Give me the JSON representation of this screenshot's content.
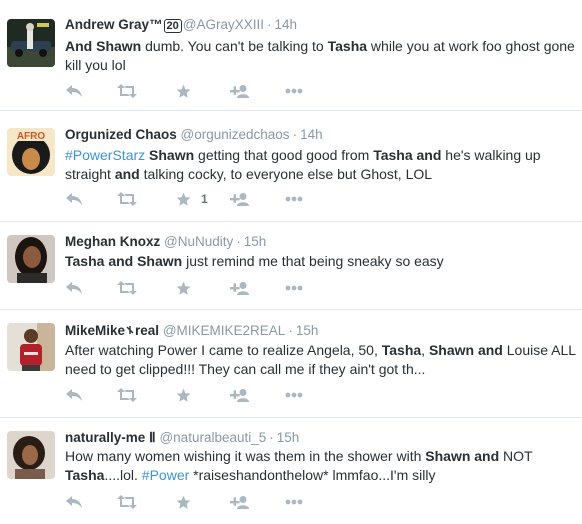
{
  "tweets": [
    {
      "name": "Andrew Gray™",
      "name_extra": "",
      "name_badge": "20",
      "handle": "@AGrayXXIII",
      "sep": "·",
      "time": "14h",
      "avatar_icon": "avatar-night-car-photo",
      "text": [
        {
          "t": "And Shawn",
          "b": true
        },
        {
          "t": " dumb. You can't be talking to "
        },
        {
          "t": "Tasha",
          "b": true
        },
        {
          "t": " while you at work foo ghost gone kill you lol"
        }
      ],
      "favorite_count": ""
    },
    {
      "name": "Orgunized Chaos",
      "name_extra": "",
      "name_badge": "",
      "handle": "@orgunizedchaos",
      "sep": "·",
      "time": "14h",
      "avatar_icon": "afro-logo-avatar",
      "avatar_text": "AFRO",
      "text": [
        {
          "t": "#PowerStarz",
          "tag": true
        },
        {
          "t": " "
        },
        {
          "t": "Shawn",
          "b": true
        },
        {
          "t": " getting that good good  from "
        },
        {
          "t": "Tasha",
          "b": true
        },
        {
          "t": " "
        },
        {
          "t": "and",
          "b": true
        },
        {
          "t": " he's walking up straight "
        },
        {
          "t": "and",
          "b": true
        },
        {
          "t": " talking cocky, to everyone else but Ghost, LOL"
        }
      ],
      "favorite_count": "1"
    },
    {
      "name": "Meghan Knoxz",
      "name_extra": "",
      "name_badge": "",
      "handle": "@NuNudity",
      "sep": "·",
      "time": "15h",
      "avatar_icon": "avatar-woman-photo",
      "text": [
        {
          "t": "Tasha and Shawn",
          "b": true
        },
        {
          "t": " just remind me that being sneaky so easy"
        }
      ],
      "favorite_count": ""
    },
    {
      "name": "MikeMike",
      "name_extra": "real",
      "name_badge": "",
      "handle": "@MIKEMIKE2REAL",
      "sep": "·",
      "time": "15h",
      "avatar_icon": "avatar-man-red-shirt-photo",
      "text": [
        {
          "t": "After watching Power I came to realize Angela, 50, "
        },
        {
          "t": "Tasha",
          "b": true
        },
        {
          "t": ", "
        },
        {
          "t": "Shawn and",
          "b": true
        },
        {
          "t": " Louise ALL need to get clipped!!! They can call me if they ain't got th..."
        }
      ],
      "favorite_count": ""
    },
    {
      "name": "naturally-me",
      "name_extra": "Ⅱ",
      "name_badge": "",
      "handle": "@naturalbeauti_5",
      "sep": "·",
      "time": "15h",
      "avatar_icon": "avatar-woman-curly-hair-photo",
      "text": [
        {
          "t": "How many women wishing it was them in the shower with "
        },
        {
          "t": "Shawn and",
          "b": true
        },
        {
          "t": " NOT "
        },
        {
          "t": "Tasha",
          "b": true
        },
        {
          "t": "....lol. "
        },
        {
          "t": "#Power",
          "tag": true
        },
        {
          "t": " *raiseshandonthelow* lmmfao...I'm silly"
        }
      ],
      "favorite_count": ""
    }
  ],
  "actions": [
    {
      "name": "reply-icon"
    },
    {
      "name": "retweet-icon"
    },
    {
      "name": "favorite-star-icon"
    },
    {
      "name": "follow-add-user-icon"
    },
    {
      "name": "more-dots-icon"
    }
  ],
  "colors": {
    "name": "#292f33",
    "meta": "#8899a6",
    "hashtag": "#3b94d9",
    "action_icon": "#aab8c2",
    "divider": "#e1e8ed"
  }
}
